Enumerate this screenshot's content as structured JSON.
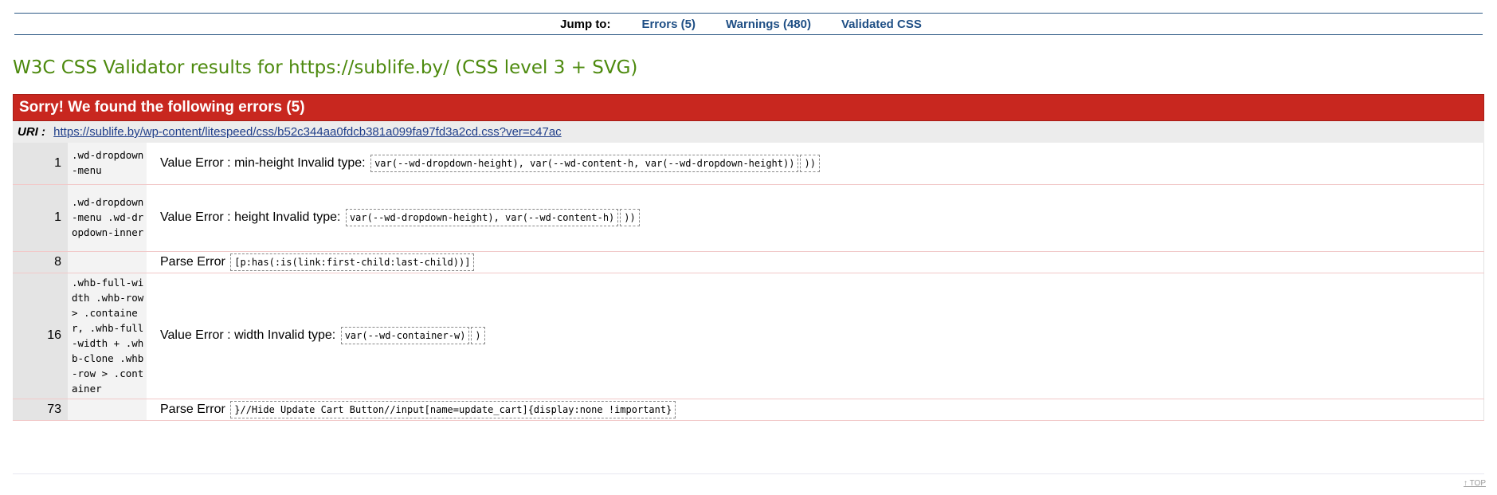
{
  "jump": {
    "label": "Jump to:",
    "links": [
      "Errors (5)",
      "Warnings (480)",
      "Validated CSS"
    ]
  },
  "title": "W3C CSS Validator results for https://sublife.by/ (CSS level 3 + SVG)",
  "errors_header": "Sorry! We found the following errors (5)",
  "uri": {
    "label": "URI :",
    "link": "https://sublife.by/wp-content/litespeed/css/b52c344aa0fdcb381a099fa97fd3a2cd.css?ver=c47ac"
  },
  "errors": [
    {
      "line": "1",
      "context": ".wd-dropdown-menu",
      "message": "Value Error : min-height Invalid type:",
      "codes": [
        "var(--wd-dropdown-height), var(--wd-content-h, var(--wd-dropdown-height))",
        "))"
      ]
    },
    {
      "line": "1",
      "context": ".wd-dropdown-menu .wd-dropdown-inner",
      "message": "Value Error : height Invalid type:",
      "codes": [
        "var(--wd-dropdown-height), var(--wd-content-h)",
        "))"
      ]
    },
    {
      "line": "8",
      "context": "",
      "message": "Parse Error",
      "codes": [
        "[p:has(:is(link:first-child:last-child))]"
      ]
    },
    {
      "line": "16",
      "context": ".whb-full-width .whb-row > .container, .whb-full-width + .whb-clone .whb-row > .container",
      "message": "Value Error : width Invalid type:",
      "codes": [
        "var(--wd-container-w)",
        ")"
      ]
    },
    {
      "line": "73",
      "context": "",
      "message": "Parse Error",
      "codes": [
        "}//Hide Update Cart Button//input[name=update_cart]{display:none !important}"
      ]
    }
  ],
  "top_link": "↑ TOP"
}
